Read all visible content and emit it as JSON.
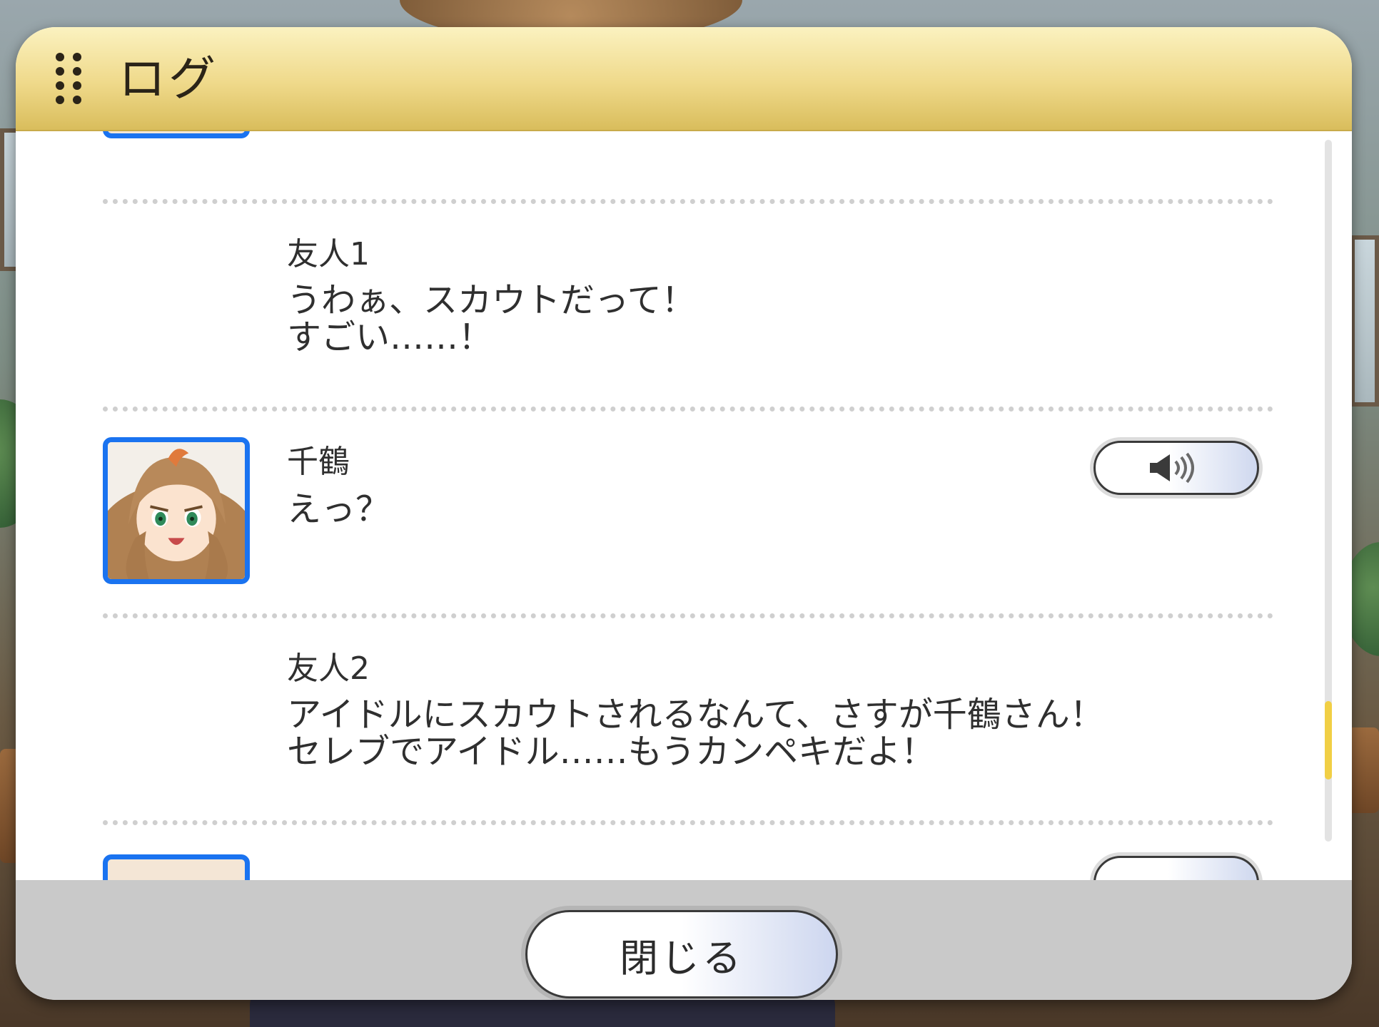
{
  "dialog": {
    "title": "ログ",
    "close_label": "閉じる"
  },
  "log": {
    "entries": [
      {
        "speaker": "友人1",
        "text": "うわぁ、スカウトだって！\nすごい……！",
        "has_avatar": false,
        "has_voice": false
      },
      {
        "speaker": "千鶴",
        "text": "えっ？",
        "has_avatar": true,
        "has_voice": true
      },
      {
        "speaker": "友人2",
        "text": "アイドルにスカウトされるなんて、さすが千鶴さん！\nセレブでアイドル……もうカンペキだよ！",
        "has_avatar": false,
        "has_voice": false
      }
    ]
  },
  "scrollbar": {
    "position_fraction": 0.9
  },
  "colors": {
    "header_gold": "#efd98a",
    "avatar_border": "#1a73f0",
    "scroll_thumb": "#f1cf45",
    "footer_gray": "#c9c9c9"
  },
  "icons": {
    "drag": "grip-icon",
    "voice": "speaker-icon"
  }
}
